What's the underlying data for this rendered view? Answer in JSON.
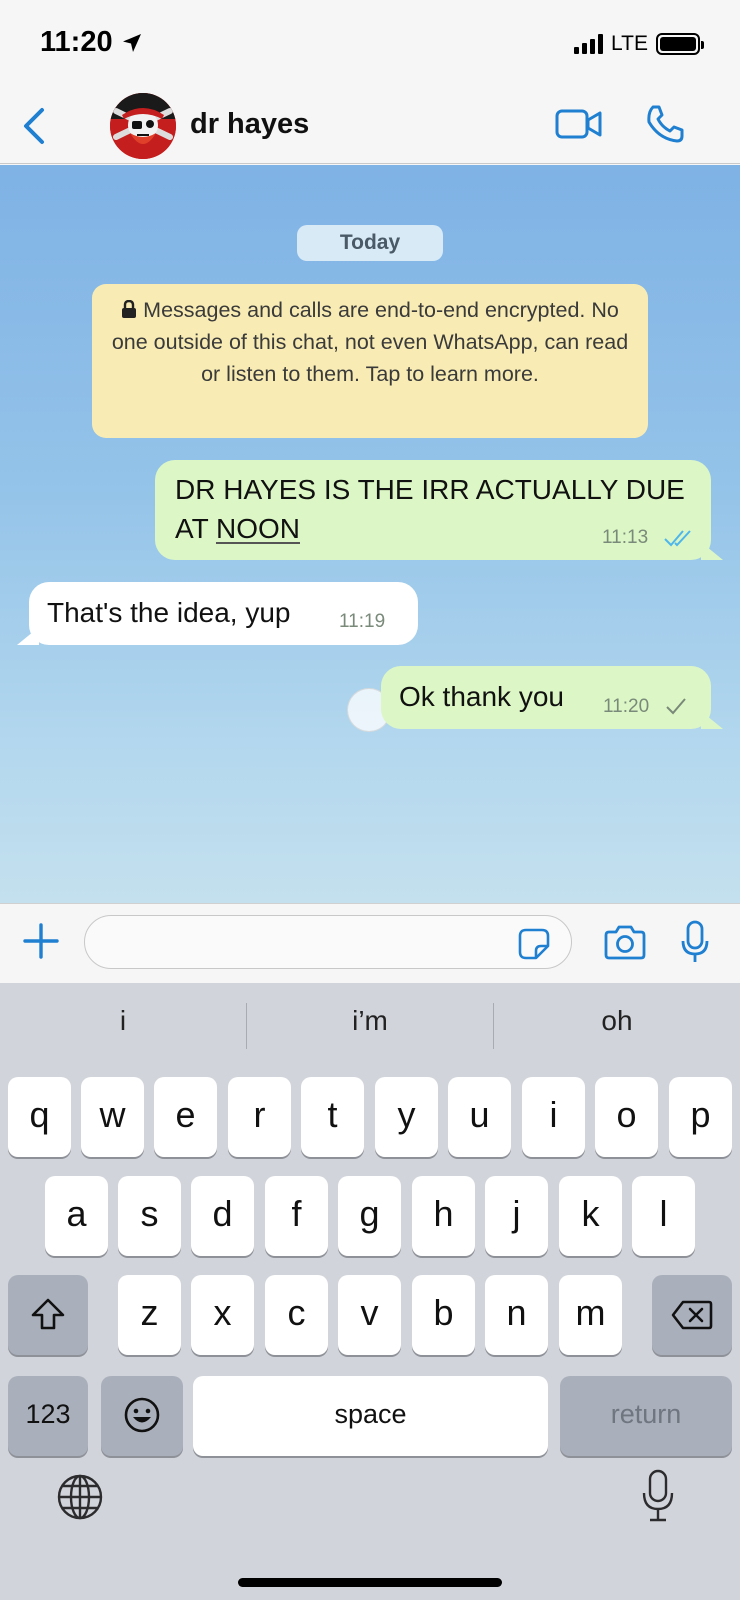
{
  "status_bar": {
    "time": "11:20",
    "network": "LTE"
  },
  "header": {
    "contact_name": "dr hayes"
  },
  "chat": {
    "date_chip": "Today",
    "encryption_notice": "Messages and calls are end-to-end encrypted. No one outside of this chat, not even WhatsApp, can read or listen to them. Tap to learn more.",
    "messages": [
      {
        "direction": "outgoing",
        "text_line1": "DR HAYES IS THE IRR ACTUALLY DUE",
        "text_line2_prefix": "AT ",
        "text_line2_link": "NOON",
        "time": "11:13",
        "status": "read"
      },
      {
        "direction": "incoming",
        "text": "That's the idea, yup",
        "time": "11:19"
      },
      {
        "direction": "outgoing",
        "text": "Ok thank you",
        "time": "11:20",
        "status": "sent"
      }
    ]
  },
  "compose": {
    "placeholder": ""
  },
  "keyboard": {
    "suggestions": [
      "i",
      "i’m",
      "oh"
    ],
    "row1": [
      "q",
      "w",
      "e",
      "r",
      "t",
      "y",
      "u",
      "i",
      "o",
      "p"
    ],
    "row2": [
      "a",
      "s",
      "d",
      "f",
      "g",
      "h",
      "j",
      "k",
      "l"
    ],
    "row3": [
      "z",
      "x",
      "c",
      "v",
      "b",
      "n",
      "m"
    ],
    "numbers_label": "123",
    "space_label": "space",
    "return_label": "return"
  },
  "colors": {
    "accent": "#1f7fd0",
    "outgoing_bubble": "#dcf7c5",
    "incoming_bubble": "#ffffff",
    "notice_bg": "#f8ecb4",
    "read_tick": "#4fb6ec"
  }
}
